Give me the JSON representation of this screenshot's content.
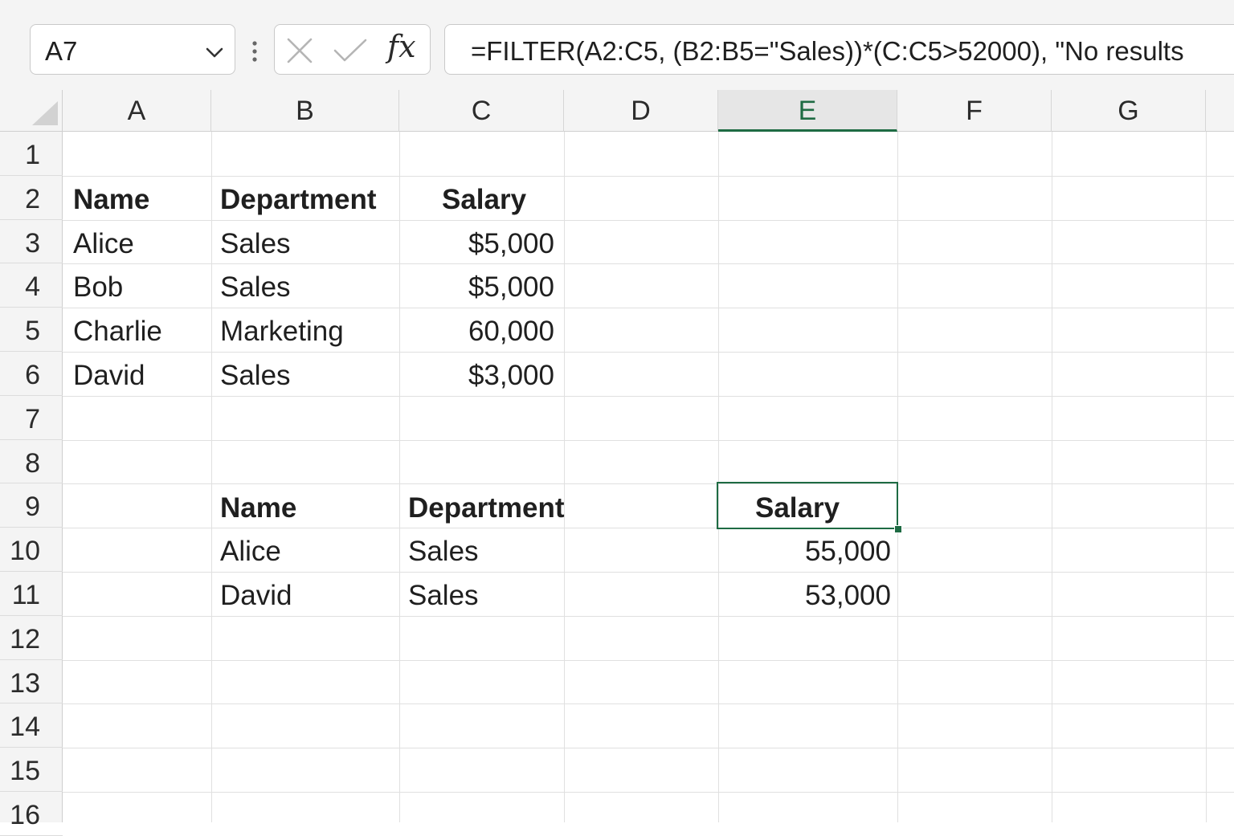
{
  "formula_bar": {
    "name_box": "A7",
    "fx_label": "fx",
    "formula": "=FILTER(A2:C5, (B2:B5=\"Sales))*(C:C5>52000), \"No results"
  },
  "columns": [
    "A",
    "B",
    "C",
    "D",
    "E",
    "F",
    "G"
  ],
  "active_column": "E",
  "rows": [
    "1",
    "2",
    "3",
    "4",
    "5",
    "6",
    "7",
    "8",
    "9",
    "10",
    "11",
    "12",
    "13",
    "14",
    "15",
    "16"
  ],
  "source_table": {
    "headers": {
      "name": "Name",
      "department": "Department",
      "salary": "Salary"
    },
    "rows": [
      {
        "name": "Alice",
        "department": "Sales",
        "salary": "$5,000"
      },
      {
        "name": "Bob",
        "department": "Sales",
        "salary": "$5,000"
      },
      {
        "name": "Charlie",
        "department": "Marketing",
        "salary": "60,000"
      },
      {
        "name": "David",
        "department": "Sales",
        "salary": "$3,000"
      }
    ]
  },
  "result_table": {
    "headers": {
      "name": "Name",
      "department": "Department",
      "salary": "Salary"
    },
    "rows": [
      {
        "name": "Alice",
        "department": "Sales",
        "salary": "55,000"
      },
      {
        "name": "David",
        "department": "Sales",
        "salary": "53,000"
      }
    ]
  },
  "colors": {
    "accent": "#1e6b43",
    "header_bg": "#f4f4f4",
    "gridline": "#e0e0e0"
  }
}
